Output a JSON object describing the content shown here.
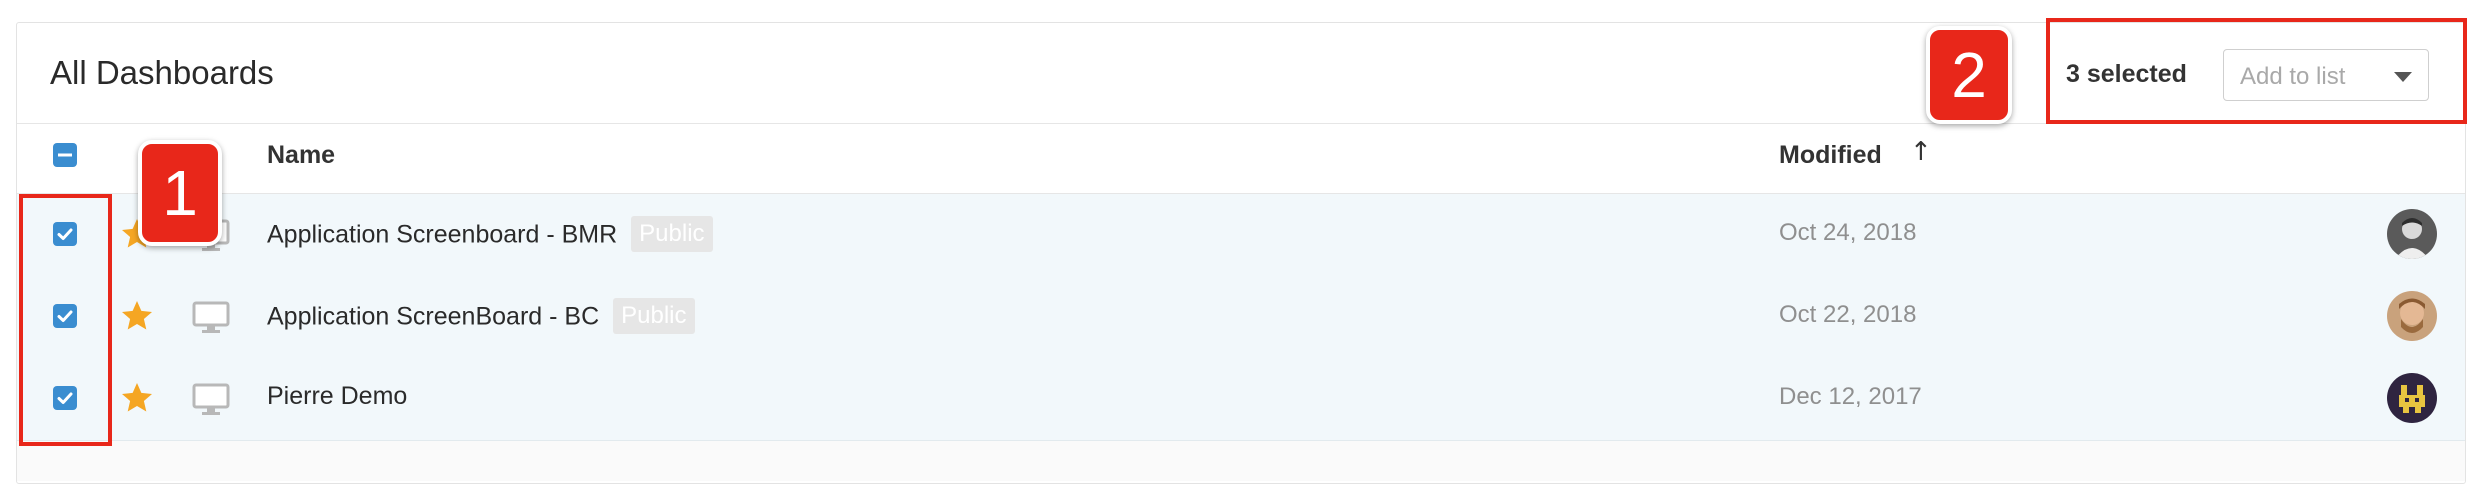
{
  "panel": {
    "title": "All Dashboards",
    "selected_count": "3 selected",
    "add_to_list_placeholder": "Add to list"
  },
  "columns": {
    "name": "Name",
    "modified": "Modified",
    "sort_indicator": "↑"
  },
  "rows": [
    {
      "name": "Application Screenboard - BMR",
      "badge": "Public",
      "modified": "Oct 24, 2018",
      "checked": true,
      "starred": true
    },
    {
      "name": "Application ScreenBoard - BC",
      "badge": "Public",
      "modified": "Oct 22, 2018",
      "checked": true,
      "starred": true
    },
    {
      "name": "Pierre Demo",
      "badge": "",
      "modified": "Dec 12, 2017",
      "checked": true,
      "starred": true
    }
  ],
  "annotations": [
    {
      "number": "1"
    },
    {
      "number": "2"
    }
  ],
  "colors": {
    "checkbox": "#3a8dd0",
    "star": "#f5a623",
    "annotation": "#e8271a",
    "selected_row": "#f2f8fb"
  },
  "icons": [
    "checkbox-icon",
    "star-icon",
    "monitor-icon",
    "caret-down-icon",
    "avatar"
  ]
}
